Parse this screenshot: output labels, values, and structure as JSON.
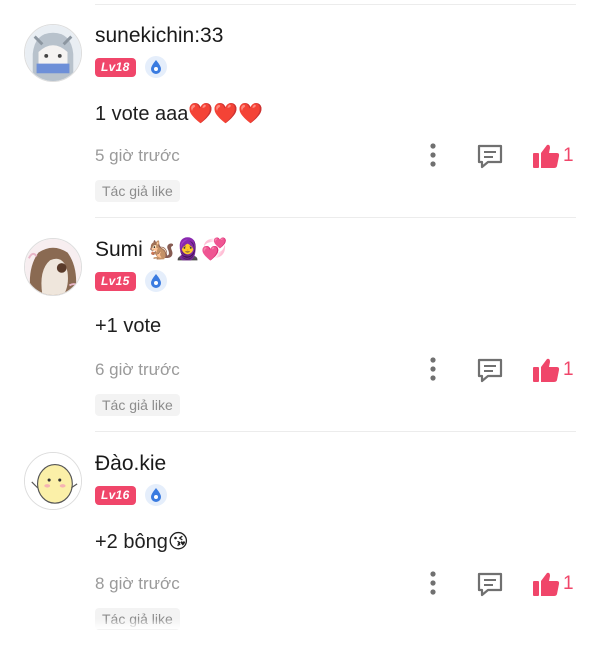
{
  "comments": [
    {
      "username": "sunekichin:33",
      "level": "Lv18",
      "text": "1 vote aaa❤️❤️❤️",
      "time": "5 giờ trước",
      "likes": "1",
      "author_like_tag": "Tác giả like"
    },
    {
      "username": "Sumi 🐿️🧕💞",
      "level": "Lv15",
      "text": "+1 vote",
      "time": "6 giờ trước",
      "likes": "1",
      "author_like_tag": "Tác giả like"
    },
    {
      "username": "Đào.kie",
      "level": "Lv16",
      "text": "+2 bông😘",
      "time": "8 giờ trước",
      "likes": "1",
      "author_like_tag": "Tác giả like"
    }
  ],
  "icons": {
    "more": "more-vertical-icon",
    "reply": "comment-reply-icon",
    "like": "thumbs-up-icon",
    "badge": "droplet-badge-icon"
  },
  "colors": {
    "accent": "#f0466a",
    "muted_text": "#9a9a9a",
    "tag_bg": "#f3f3f3"
  }
}
